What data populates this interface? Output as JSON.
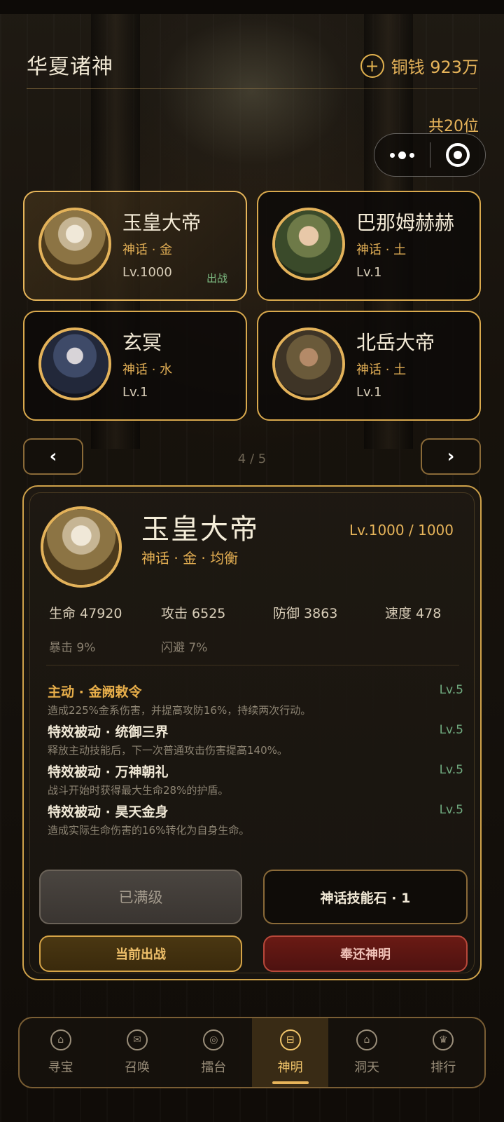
{
  "header": {
    "title": "华夏诸神",
    "currency_label": "铜钱 923万",
    "add_icon": "plus-circle-icon"
  },
  "count_label": "共20位",
  "gods": [
    {
      "name": "玉皇大帝",
      "meta": "神话 · 金",
      "level": "Lv.1000",
      "tag": "出战"
    },
    {
      "name": "巴那姆赫赫",
      "meta": "神话 · 土",
      "level": "Lv.1"
    },
    {
      "name": "玄冥",
      "meta": "神话 · 水",
      "level": "Lv.1"
    },
    {
      "name": "北岳大帝",
      "meta": "神话 · 土",
      "level": "Lv.1"
    }
  ],
  "pager": {
    "prev": "‹",
    "next": "›",
    "text": "4 / 5"
  },
  "detail": {
    "name": "玉皇大帝",
    "meta": "神话 · 金 · 均衡",
    "level": "Lv.1000 / 1000",
    "stats": [
      "生命 47920",
      "攻击 6525",
      "防御 3863",
      "速度 478"
    ],
    "sub_stats": [
      "暴击 9%",
      "闪避 7%"
    ],
    "skills": [
      {
        "title": "主动 · 金阙敕令",
        "level": "Lv.5",
        "desc": "造成225%金系伤害，并提高攻防16%，持续两次行动。"
      },
      {
        "title": "特效被动 · 统御三界",
        "level": "Lv.5",
        "desc": "释放主动技能后，下一次普通攻击伤害提高140%。"
      },
      {
        "title": "特效被动 · 万神朝礼",
        "level": "Lv.5",
        "desc": "战斗开始时获得最大生命28%的护盾。"
      },
      {
        "title": "特效被动 · 昊天金身",
        "level": "Lv.5",
        "desc": "造成实际生命伤害的16%转化为自身生命。"
      }
    ],
    "buttons": {
      "max": "已满级",
      "stone": "神话技能石 · 1",
      "current": "当前出战",
      "return": "奉还神明"
    }
  },
  "nav": [
    {
      "label": "寻宝",
      "icon": "treasure-icon"
    },
    {
      "label": "召唤",
      "icon": "summon-icon"
    },
    {
      "label": "擂台",
      "icon": "arena-icon"
    },
    {
      "label": "神明",
      "icon": "deity-icon"
    },
    {
      "label": "洞天",
      "icon": "cave-icon"
    },
    {
      "label": "排行",
      "icon": "ranking-icon"
    }
  ],
  "colors": {
    "accent": "#e7b45a",
    "active_tag": "#7dbb82",
    "danger": "#6a1a14"
  }
}
